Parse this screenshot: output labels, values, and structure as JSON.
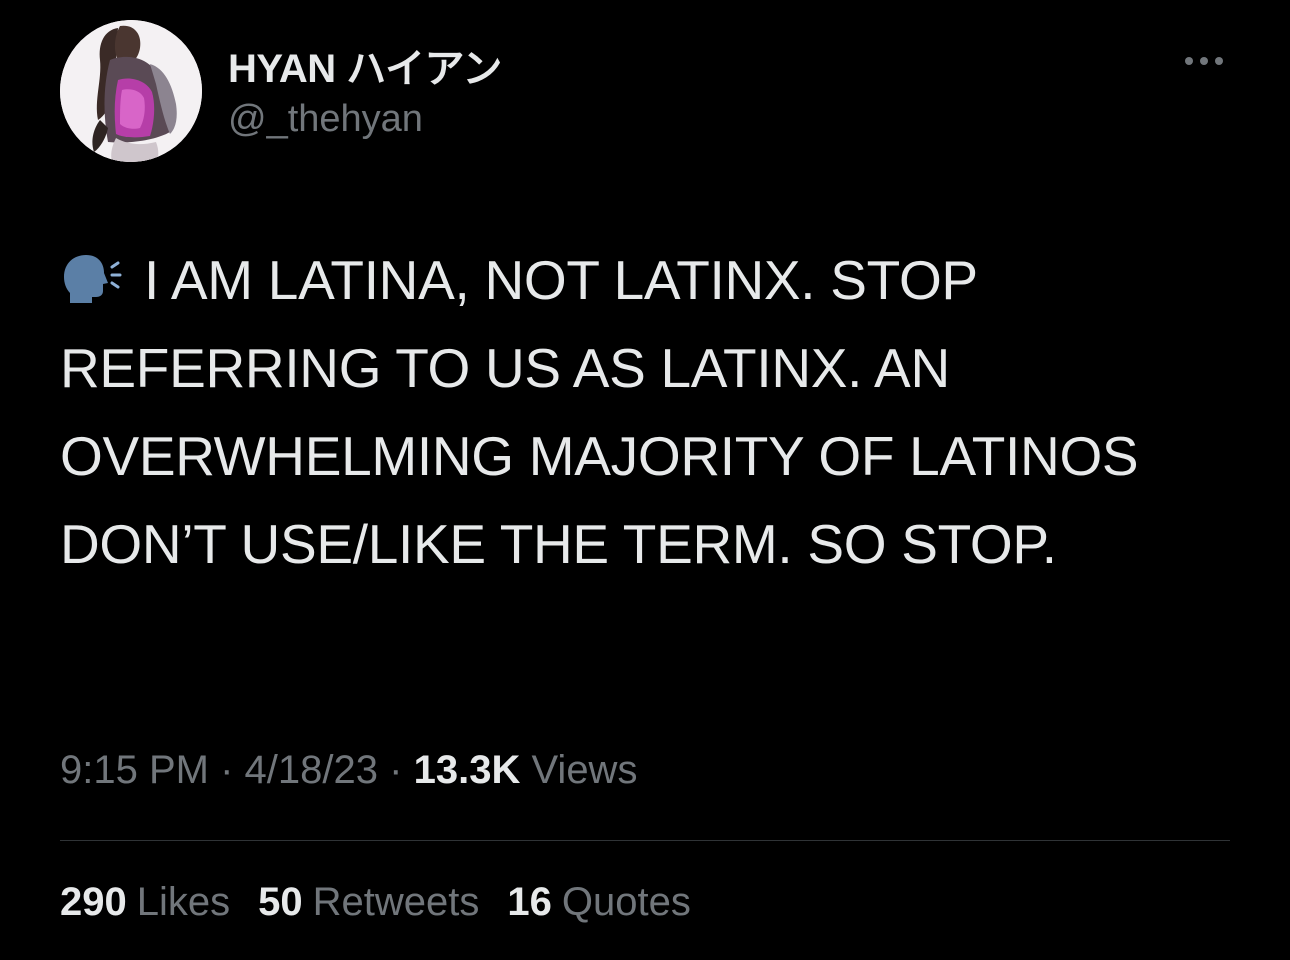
{
  "tweet": {
    "author": {
      "display_name": "HYAN ハイアン",
      "handle": "@_thehyan"
    },
    "more_icon": "more-horizontal-icon",
    "speaking_icon": "speaking-head-icon",
    "text": "I AM LATINA, NOT LATINX. STOP REFERRING TO US AS LATINX. AN OVERWHELMING MAJORITY OF LATINOS DON’T USE/LIKE THE TERM. SO STOP.",
    "time": "9:15 PM",
    "separator": "·",
    "date": "4/18/23",
    "views_count": "13.3K",
    "views_label": "Views"
  },
  "stats": {
    "likes_count": "290",
    "likes_label": "Likes",
    "retweets_count": "50",
    "retweets_label": "Retweets",
    "quotes_count": "16",
    "quotes_label": "Quotes"
  },
  "colors": {
    "background": "#000000",
    "primary_text": "#e7e9ea",
    "secondary_text": "#71767b",
    "divider": "#2f3336",
    "icon_blue": "#5b7fa6"
  }
}
